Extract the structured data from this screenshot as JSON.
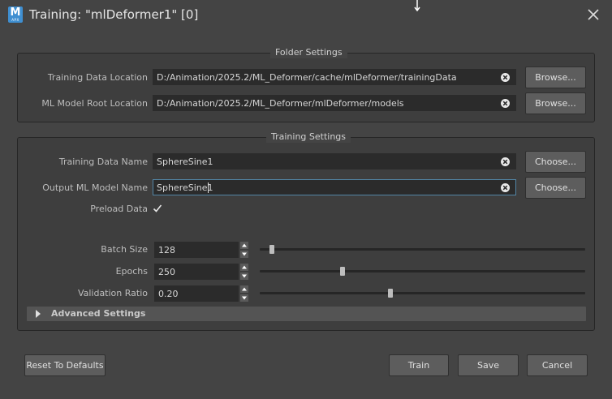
{
  "window": {
    "title": "Training: \"mlDeformer1\" [0]",
    "logo_letter": "M",
    "logo_sub": "APX"
  },
  "folder_settings": {
    "title": "Folder Settings",
    "training_data_location": {
      "label": "Training Data Location",
      "value": "D:/Animation/2025.2/ML_Deformer/cache/mlDeformer/trainingData",
      "button": "Browse..."
    },
    "ml_model_root_location": {
      "label": "ML Model Root Location",
      "value": "D:/Animation/2025.2/ML_Deformer/mlDeformer/models",
      "button": "Browse..."
    }
  },
  "training_settings": {
    "title": "Training Settings",
    "training_data_name": {
      "label": "Training Data Name",
      "value": "SphereSine1",
      "button": "Choose..."
    },
    "output_ml_model_name": {
      "label": "Output ML Model Name",
      "value": "SphereSine1",
      "button": "Choose..."
    },
    "preload_data": {
      "label": "Preload Data",
      "checked": true
    },
    "batch_size": {
      "label": "Batch Size",
      "value": "128",
      "slider_fraction": 0.03
    },
    "epochs": {
      "label": "Epochs",
      "value": "250",
      "slider_fraction": 0.25
    },
    "validation_ratio": {
      "label": "Validation Ratio",
      "value": "0.20",
      "slider_fraction": 0.4
    },
    "advanced_settings": {
      "label": "Advanced Settings",
      "expanded": false
    }
  },
  "footer": {
    "reset_label": "Reset To Defaults",
    "train_label": "Train",
    "save_label": "Save",
    "cancel_label": "Cancel"
  },
  "colors": {
    "background": "#444444",
    "field": "#2b2b2b",
    "focus_border": "#5285a6",
    "button": "#5d5d5d",
    "logo": "#3f8fd1"
  }
}
